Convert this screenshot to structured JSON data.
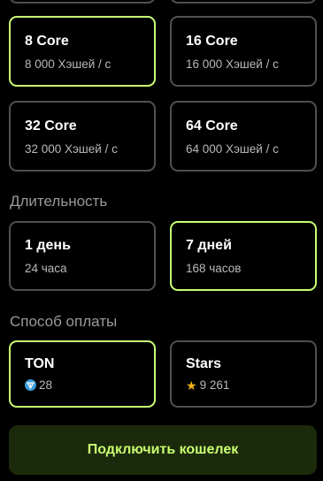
{
  "power_options": [
    {
      "title": "8 Core",
      "subtitle": "8 000 Хэшей / с",
      "selected": true
    },
    {
      "title": "16 Core",
      "subtitle": "16 000 Хэшей / с",
      "selected": false
    },
    {
      "title": "32 Core",
      "subtitle": "32 000 Хэшей / с",
      "selected": false
    },
    {
      "title": "64 Core",
      "subtitle": "64 000 Хэшей / с",
      "selected": false
    }
  ],
  "duration": {
    "section_title": "Длительность",
    "options": [
      {
        "title": "1 день",
        "subtitle": "24 часа",
        "selected": false
      },
      {
        "title": "7 дней",
        "subtitle": "168 часов",
        "selected": true
      }
    ]
  },
  "payment": {
    "section_title": "Способ оплаты",
    "options": [
      {
        "title": "TON",
        "price": "28",
        "icon": "ton-icon",
        "selected": true
      },
      {
        "title": "Stars",
        "price": "9 261",
        "icon": "star-icon",
        "selected": false
      }
    ]
  },
  "connect_button": "Подключить кошелек",
  "colors": {
    "accent": "#c9ff72",
    "border": "#505050",
    "button_bg": "#1b2a0a"
  }
}
